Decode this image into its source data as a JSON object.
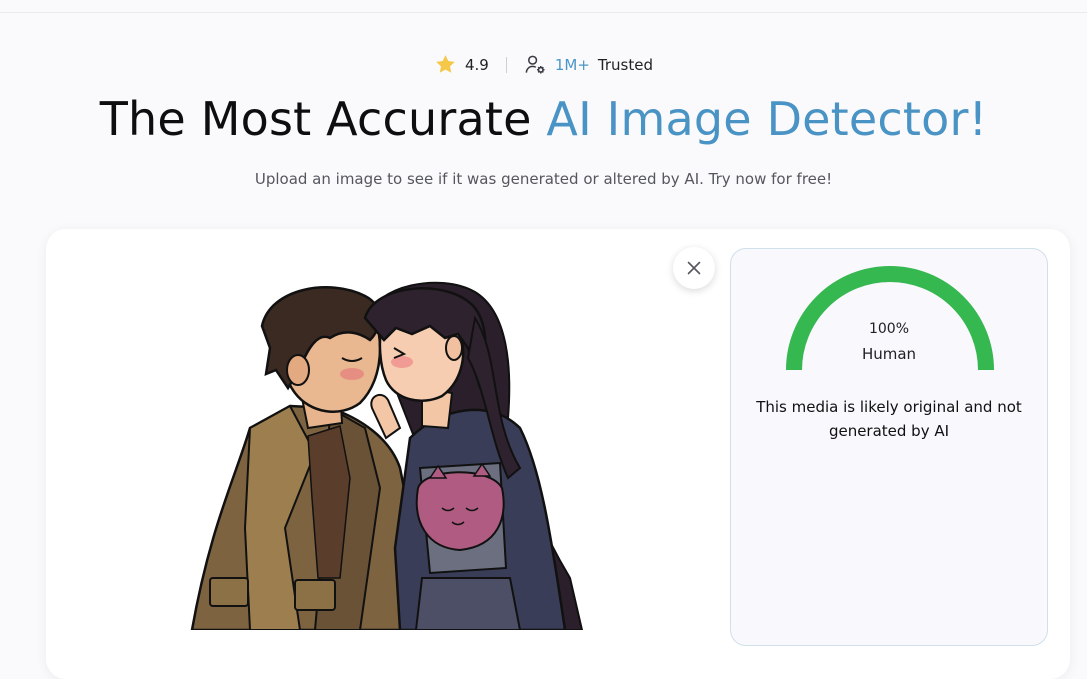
{
  "rating": {
    "score": "4.9",
    "icon": "star-icon",
    "trust_icon": "user-settings-icon",
    "trusted_count": "1M+",
    "trusted_label": "Trusted"
  },
  "hero": {
    "title_main": "The Most Accurate ",
    "title_accent": "AI Image Detector!",
    "subtitle": "Upload an image to see if it was generated or altered by AI. Try now for free!"
  },
  "colors": {
    "accent": "#4a93c5",
    "gauge_fill": "#35b84f",
    "star": "#f5c84a"
  },
  "upload": {
    "image_description_icon": "uploaded-image",
    "close_icon": "close-icon"
  },
  "result": {
    "percent": "100%",
    "human_fraction": 1.0,
    "label": "Human",
    "verdict": "This media is likely original and not generated by AI"
  }
}
